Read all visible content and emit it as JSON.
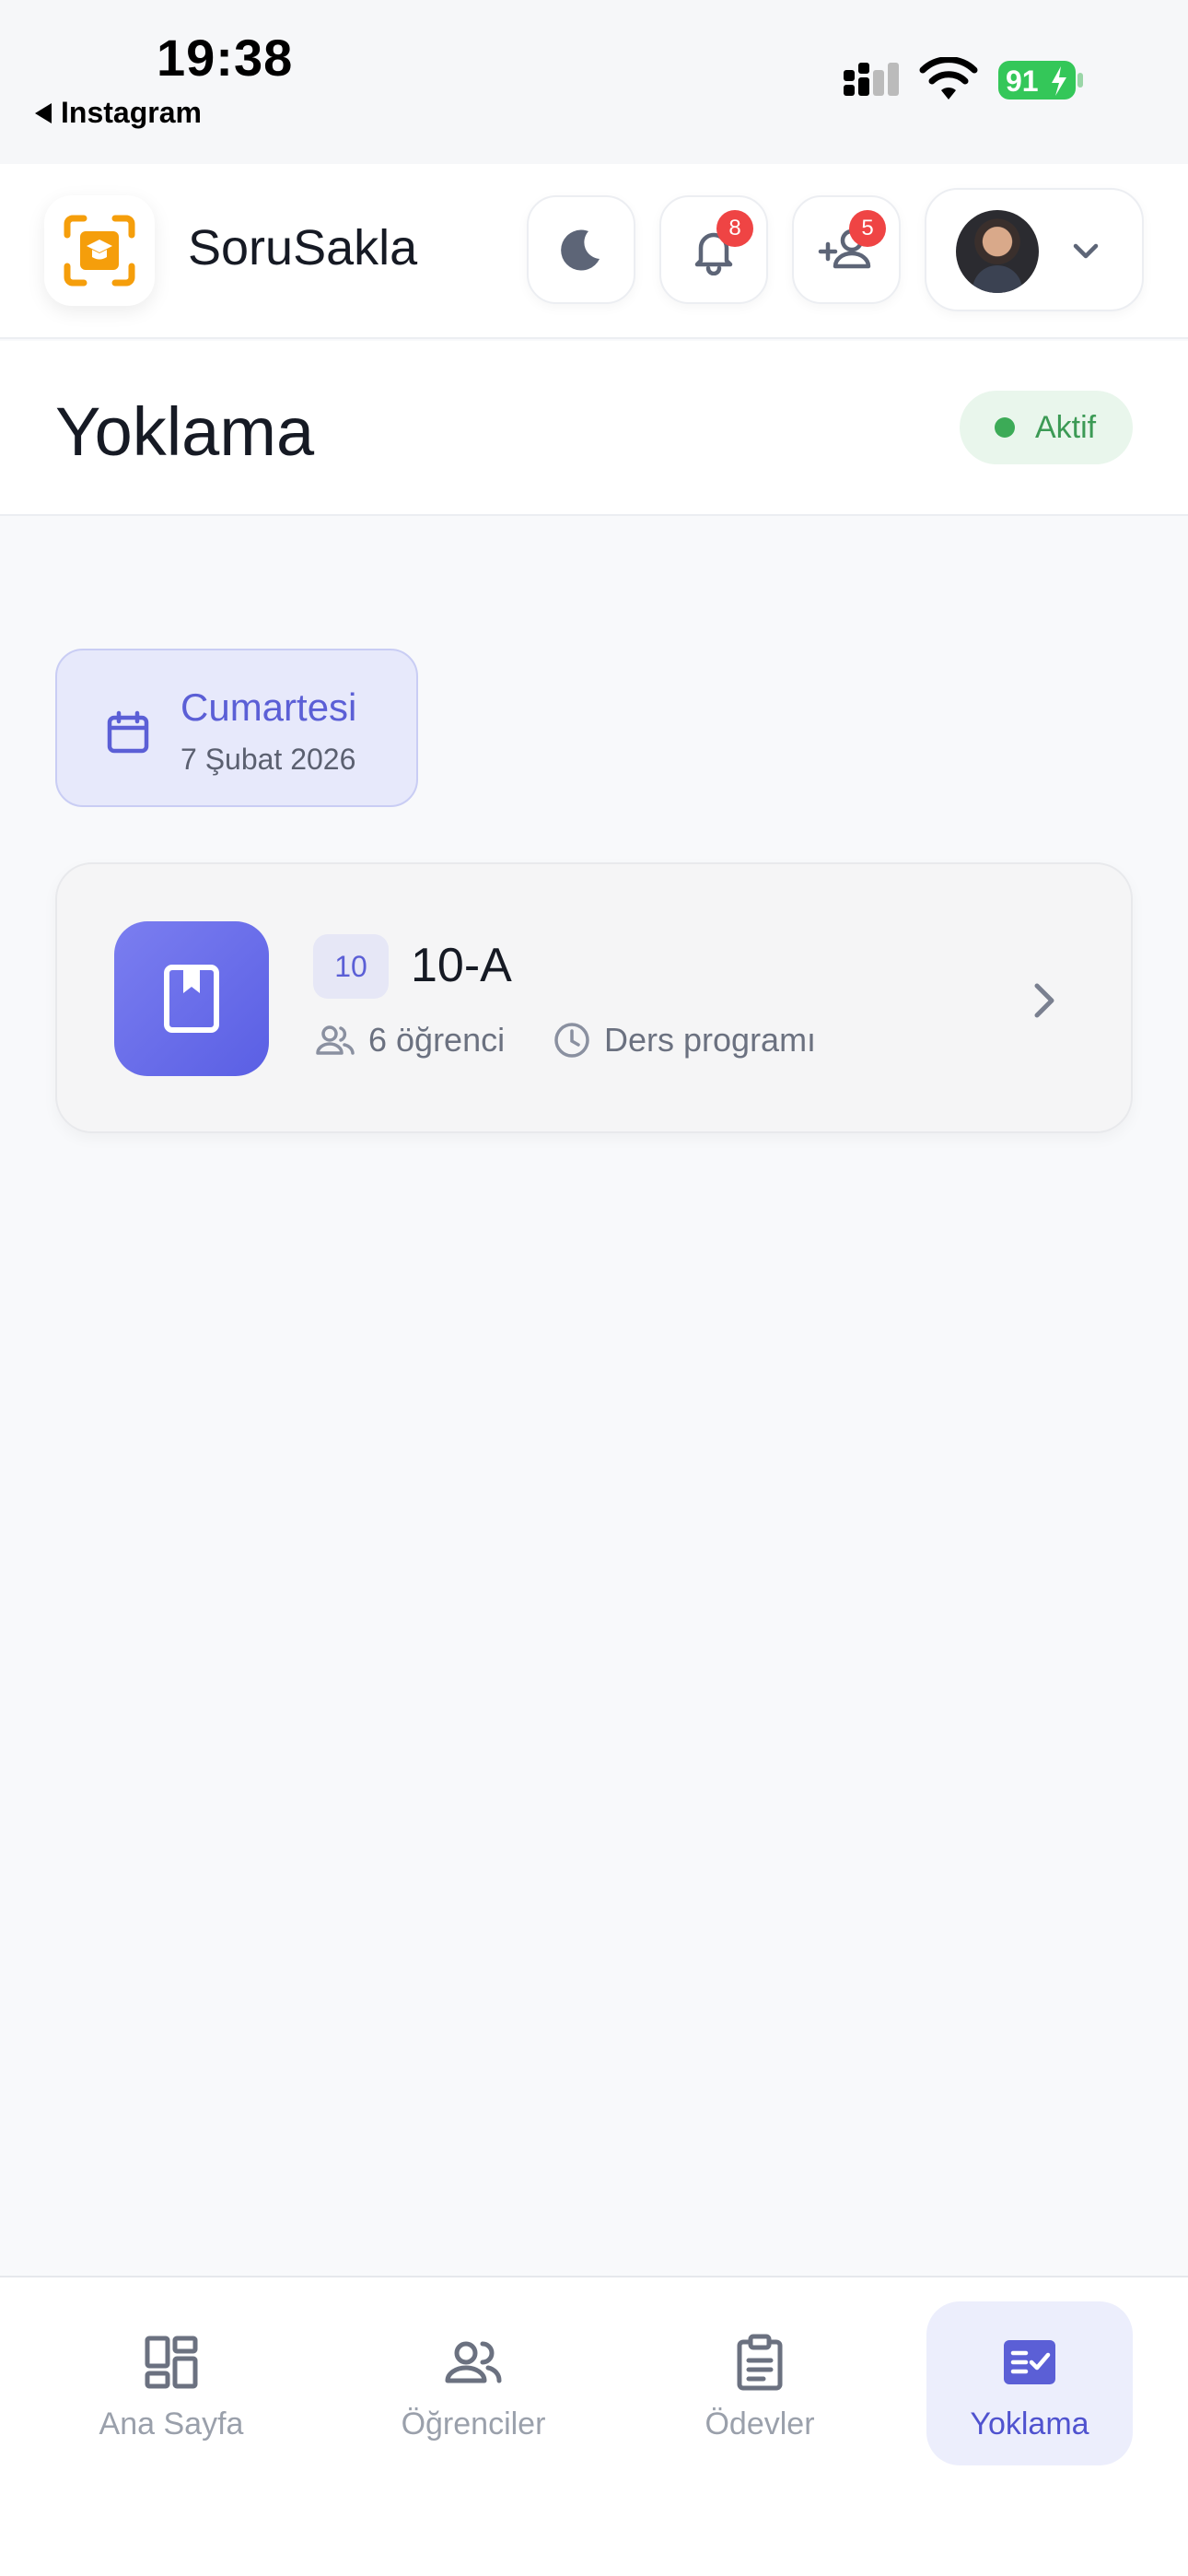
{
  "status_bar": {
    "time": "19:38",
    "back_label": "Instagram",
    "battery": "91"
  },
  "header": {
    "brand": "SoruSakla",
    "notifications_count": "8",
    "requests_count": "5"
  },
  "page": {
    "title": "Yoklama",
    "status": "Aktif"
  },
  "date_card": {
    "day": "Cumartesi",
    "date": "7 Şubat 2026"
  },
  "class_card": {
    "grade": "10",
    "name": "10-A",
    "students": "6 öğrenci",
    "schedule": "Ders programı"
  },
  "bottom_nav": {
    "items": [
      {
        "label": "Ana Sayfa",
        "icon": "dashboard-icon"
      },
      {
        "label": "Öğrenciler",
        "icon": "users-icon"
      },
      {
        "label": "Ödevler",
        "icon": "clipboard-icon"
      },
      {
        "label": "Yoklama",
        "icon": "checklist-icon"
      }
    ]
  },
  "colors": {
    "accent": "#5b5fd6",
    "active_status": "#3cab57",
    "badge": "#ef4444",
    "logo": "#f59e0b"
  }
}
